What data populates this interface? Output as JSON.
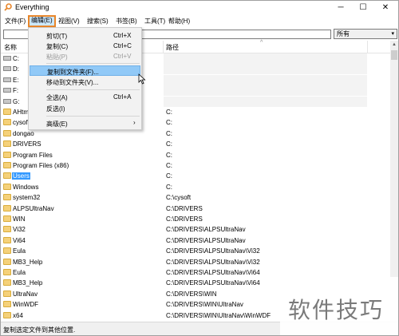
{
  "window": {
    "title": "Everything"
  },
  "titlebar": {
    "minimize": "─",
    "maximize": "☐",
    "close": "✕"
  },
  "menubar": {
    "file": "文件(F)",
    "edit": "编辑(E)",
    "view": "视图(V)",
    "search": "搜索(S)",
    "bookmarks": "书签(B)",
    "tools": "工具(T)",
    "help": "帮助(H)"
  },
  "search": {
    "value": "",
    "filter": "所有"
  },
  "columns": {
    "name": "名称",
    "path": "路径"
  },
  "edit_menu": {
    "cut": {
      "label": "剪切(T)",
      "shortcut": "Ctrl+X"
    },
    "copy": {
      "label": "复制(C)",
      "shortcut": "Ctrl+C"
    },
    "paste": {
      "label": "粘贴(P)",
      "shortcut": "Ctrl+V"
    },
    "copy_to_folder": {
      "label": "复制到文件夹(F)..."
    },
    "move_to_folder": {
      "label": "移动到文件夹(V)..."
    },
    "select_all": {
      "label": "全选(A)",
      "shortcut": "Ctrl+A"
    },
    "invert_selection": {
      "label": "反选(I)"
    },
    "advanced": {
      "label": "高级(E)"
    }
  },
  "rows": [
    {
      "name": "C:",
      "path": "",
      "type": "drive"
    },
    {
      "name": "D:",
      "path": "",
      "type": "drive"
    },
    {
      "name": "E:",
      "path": "",
      "type": "drive"
    },
    {
      "name": "F:",
      "path": "",
      "type": "drive"
    },
    {
      "name": "G:",
      "path": "",
      "type": "drive"
    },
    {
      "name": "AHtm",
      "path": "C:",
      "type": "folder"
    },
    {
      "name": "cysof",
      "path": "C:",
      "type": "folder"
    },
    {
      "name": "dongao",
      "path": "C:",
      "type": "folder"
    },
    {
      "name": "DRIVERS",
      "path": "C:",
      "type": "folder"
    },
    {
      "name": "Program Files",
      "path": "C:",
      "type": "folder"
    },
    {
      "name": "Program Files (x86)",
      "path": "C:",
      "type": "folder"
    },
    {
      "name": "Users",
      "path": "C:",
      "type": "folder",
      "selected": true
    },
    {
      "name": "Windows",
      "path": "C:",
      "type": "folder"
    },
    {
      "name": "system32",
      "path": "C:\\cysoft",
      "type": "folder"
    },
    {
      "name": "ALPSUltraNav",
      "path": "C:\\DRIVERS",
      "type": "folder"
    },
    {
      "name": "WIN",
      "path": "C:\\DRIVERS",
      "type": "folder"
    },
    {
      "name": "Vi32",
      "path": "C:\\DRIVERS\\ALPSUltraNav",
      "type": "folder"
    },
    {
      "name": "Vi64",
      "path": "C:\\DRIVERS\\ALPSUltraNav",
      "type": "folder"
    },
    {
      "name": "Eula",
      "path": "C:\\DRIVERS\\ALPSUltraNav\\Vi32",
      "type": "folder"
    },
    {
      "name": "MB3_Help",
      "path": "C:\\DRIVERS\\ALPSUltraNav\\Vi32",
      "type": "folder"
    },
    {
      "name": "Eula",
      "path": "C:\\DRIVERS\\ALPSUltraNav\\Vi64",
      "type": "folder"
    },
    {
      "name": "MB3_Help",
      "path": "C:\\DRIVERS\\ALPSUltraNav\\Vi64",
      "type": "folder"
    },
    {
      "name": "UltraNav",
      "path": "C:\\DRIVERS\\WIN",
      "type": "folder"
    },
    {
      "name": "WinWDF",
      "path": "C:\\DRIVERS\\WIN\\UltraNav",
      "type": "folder"
    },
    {
      "name": "x64",
      "path": "C:\\DRIVERS\\WIN\\UltraNav\\WinWDF",
      "type": "folder"
    }
  ],
  "status": {
    "text": "复制选定文件到其他位置."
  },
  "watermark": {
    "text": "软件技巧"
  }
}
